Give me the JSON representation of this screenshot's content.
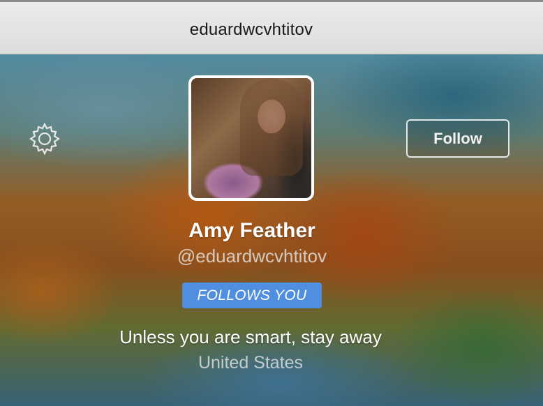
{
  "window": {
    "title": "eduardwcvhtitov"
  },
  "profile": {
    "name": "Amy Feather",
    "handle": "@eduardwcvhtitov",
    "follows_badge": "FOLLOWS YOU",
    "bio": "Unless you are smart, stay away",
    "location": "United States"
  },
  "actions": {
    "follow_label": "Follow",
    "settings_icon": "gear-icon"
  },
  "colors": {
    "badge": "#4f8ee0",
    "titlebar": "#e6e6e6"
  }
}
